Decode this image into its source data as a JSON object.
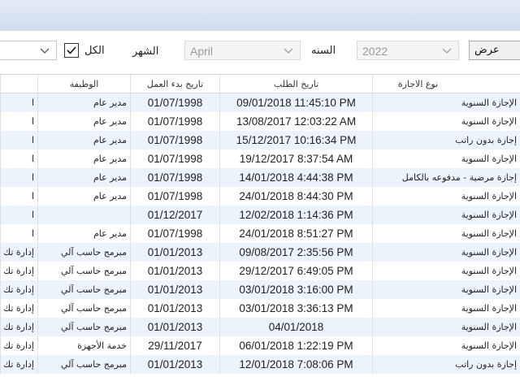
{
  "toolbar": {
    "show_button_label": "عرض",
    "year_label": "السنه",
    "year_value": "2022",
    "month_label": "الشهر",
    "month_value": "April",
    "all_label": "الكل",
    "all_checked": true
  },
  "table": {
    "headers": {
      "leave_type": "نوع الاجازة",
      "request_date": "تاريخ الطلب",
      "start_date": "تاريخ بدء العمل",
      "job": "الوظيفة"
    },
    "rows": [
      {
        "dept": "ا",
        "job": "مدير عام",
        "start_date": "01/07/1998",
        "request_date": "09/01/2018 11:45:10 PM",
        "leave_type": "الإجازة السنوية"
      },
      {
        "dept": "ا",
        "job": "مدير عام",
        "start_date": "01/07/1998",
        "request_date": "13/08/2017 12:03:22 AM",
        "leave_type": "الإجازة السنوية"
      },
      {
        "dept": "ا",
        "job": "مدير عام",
        "start_date": "01/07/1998",
        "request_date": "15/12/2017 10:16:34 PM",
        "leave_type": "إجازة بدون راتب"
      },
      {
        "dept": "ا",
        "job": "مدير عام",
        "start_date": "01/07/1998",
        "request_date": "19/12/2017 8:37:54 AM",
        "leave_type": "الإجازة السنوية"
      },
      {
        "dept": "ا",
        "job": "مدير عام",
        "start_date": "01/07/1998",
        "request_date": "14/01/2018 4:44:38 PM",
        "leave_type": "إجازة مرضية - مدفوعه بالكامل"
      },
      {
        "dept": "ا",
        "job": "مدير عام",
        "start_date": "01/07/1998",
        "request_date": "24/01/2018 8:44:30 PM",
        "leave_type": "الإجازة السنوية"
      },
      {
        "dept": "ا",
        "job": "",
        "start_date": "01/12/2017",
        "request_date": "12/02/2018 1:14:36 PM",
        "leave_type": "الإجازة السنوية"
      },
      {
        "dept": "ا",
        "job": "مدير عام",
        "start_date": "01/07/1998",
        "request_date": "24/01/2018 8:51:27 PM",
        "leave_type": "الإجازة السنوية"
      },
      {
        "dept": "إدارة تك",
        "job": "مبرمج حاسب آلي",
        "start_date": "01/01/2013",
        "request_date": "09/08/2017 2:35:56 PM",
        "leave_type": "الإجازة السنوية"
      },
      {
        "dept": "إدارة تك",
        "job": "مبرمج حاسب آلي",
        "start_date": "01/01/2013",
        "request_date": "29/12/2017 6:49:05 PM",
        "leave_type": "الإجازة السنوية"
      },
      {
        "dept": "إدارة تك",
        "job": "مبرمج حاسب آلي",
        "start_date": "01/01/2013",
        "request_date": "03/01/2018 3:16:00 PM",
        "leave_type": "الإجازة السنوية"
      },
      {
        "dept": "إدارة تك",
        "job": "مبرمج حاسب آلي",
        "start_date": "01/01/2013",
        "request_date": "03/01/2018 3:36:13 PM",
        "leave_type": "الإجازة السنوية"
      },
      {
        "dept": "إدارة تك",
        "job": "مبرمج حاسب آلي",
        "start_date": "01/01/2013",
        "request_date": "04/01/2018",
        "leave_type": "الإجازة السنوية"
      },
      {
        "dept": "إدارة تك",
        "job": "خدمة الأجهزة",
        "start_date": "29/11/2017",
        "request_date": "06/01/2018 1:22:19 PM",
        "leave_type": "الإجازة السنوية"
      },
      {
        "dept": "إدارة تك",
        "job": "مبرمج حاسب آلي",
        "start_date": "01/01/2013",
        "request_date": "12/01/2018 7:08:06 PM",
        "leave_type": "إجازة بدون راتب"
      }
    ]
  },
  "colors": {
    "row_alt": "#ecf3fc",
    "titlebar": "#d6e2f1"
  }
}
